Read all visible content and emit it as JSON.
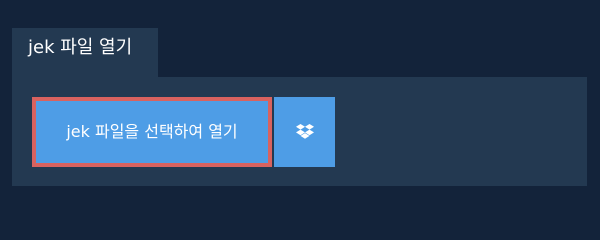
{
  "tab": {
    "label": "jek 파일 열기"
  },
  "panel": {
    "open_file_button_label": "jek 파일을 선택하여 열기",
    "dropbox_icon": "dropbox-icon"
  },
  "colors": {
    "background": "#13233a",
    "panel": "#233951",
    "button": "#4e9de6",
    "highlight_border": "#d9625f",
    "text": "#ffffff"
  }
}
